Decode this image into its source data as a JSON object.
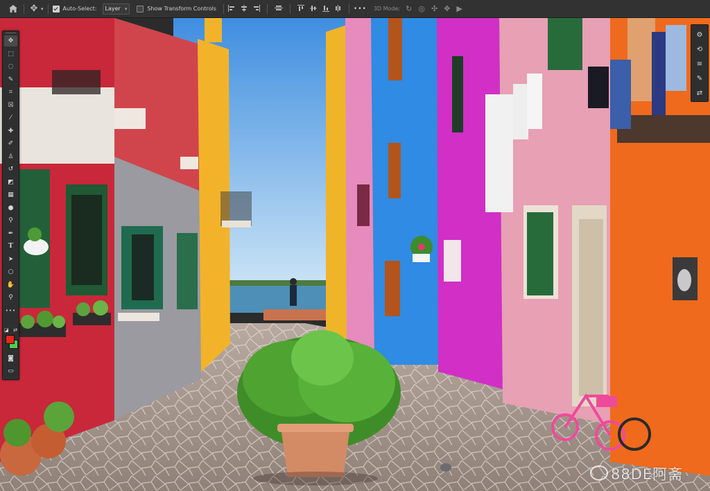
{
  "options_bar": {
    "auto_select_label": "Auto-Select:",
    "auto_select_checked": true,
    "auto_select_target": "Layer",
    "show_transform_label": "Show Transform Controls",
    "show_transform_checked": false,
    "more_label": "•••",
    "mode_3d_label": "3D Mode:"
  },
  "toolbar": {
    "foreground_color": "#e8271d",
    "background_color": "#4dd04f",
    "tools": [
      {
        "name": "move-tool",
        "glyph": "✥"
      },
      {
        "name": "marquee-tool",
        "glyph": "⬚"
      },
      {
        "name": "lasso-tool",
        "glyph": "◌"
      },
      {
        "name": "quick-select-tool",
        "glyph": "✎"
      },
      {
        "name": "crop-tool",
        "glyph": "⌗"
      },
      {
        "name": "frame-tool",
        "glyph": "☒"
      },
      {
        "name": "eyedropper-tool",
        "glyph": "⁄"
      },
      {
        "name": "healing-brush-tool",
        "glyph": "✚"
      },
      {
        "name": "brush-tool",
        "glyph": "✐"
      },
      {
        "name": "clone-stamp-tool",
        "glyph": "♙"
      },
      {
        "name": "history-brush-tool",
        "glyph": "↺"
      },
      {
        "name": "eraser-tool",
        "glyph": "◩"
      },
      {
        "name": "gradient-tool",
        "glyph": "▦"
      },
      {
        "name": "blur-tool",
        "glyph": "●"
      },
      {
        "name": "dodge-tool",
        "glyph": "⚲"
      },
      {
        "name": "pen-tool",
        "glyph": "✒"
      },
      {
        "name": "type-tool",
        "glyph": "T"
      },
      {
        "name": "path-select-tool",
        "glyph": "➤"
      },
      {
        "name": "ellipse-tool",
        "glyph": "○"
      },
      {
        "name": "hand-tool",
        "glyph": "✋"
      },
      {
        "name": "zoom-tool",
        "glyph": "⚲"
      },
      {
        "name": "edit-toolbar",
        "glyph": "•••"
      }
    ]
  },
  "right_panel": {
    "items": [
      {
        "name": "properties-icon",
        "glyph": "⚙"
      },
      {
        "name": "history-icon",
        "glyph": "⟲"
      },
      {
        "name": "brush-settings-icon",
        "glyph": "≡"
      },
      {
        "name": "brush-icon",
        "glyph": "✎"
      },
      {
        "name": "adjustments-icon",
        "glyph": "⇄"
      }
    ]
  },
  "canvas": {
    "photo_subject": "colorful street"
  },
  "watermark": {
    "text": "88DE阿斋"
  }
}
